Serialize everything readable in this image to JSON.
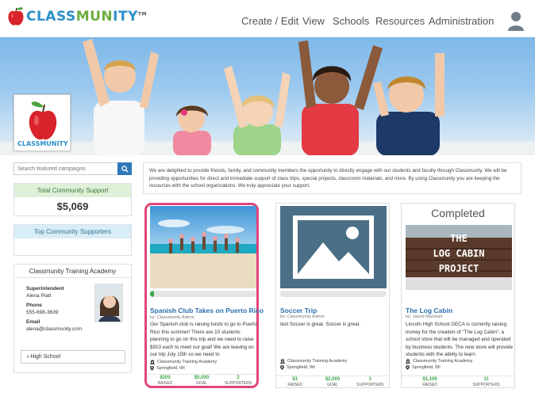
{
  "brand": {
    "name_part1": "CLASS",
    "name_part2": "MUN",
    "name_part3": "ITY",
    "tm": "TM",
    "badge_text": "CLASSMUNITY"
  },
  "nav": {
    "items": [
      "Create / Edit",
      "View",
      "Schools",
      "Resources",
      "Administration"
    ]
  },
  "search": {
    "placeholder": "Search featured campaigns"
  },
  "total_support": {
    "label": "Total Community Support",
    "value": "$5,069"
  },
  "top_supporters": {
    "label": "Top Community Supporters"
  },
  "academy": {
    "title": "Classmunity Training Academy",
    "role": "Superintendent",
    "name": "Alena Platt",
    "phone_label": "Phone",
    "phone": "555-698-3639",
    "email_label": "Email",
    "email": "alena@classmunity.com",
    "school_button": "High School"
  },
  "intro": {
    "text": "We are delighted to provide friends, family, and community members the opportunity to directly engage with our students and faculty through Classmunity. We will be providing opportunities for direct and immediate support of class trips, special projects, classroom materials, and more. By using Classmunity you are keeping the resources with the school organizations. We truly appreciate your support."
  },
  "campaigns": [
    {
      "title": "Spanish Club Takes on Puerto Rico",
      "by": "by: Classmunity Admin",
      "description": "Our Spanish club is raising funds to go to Puerto Rico this summer! There are 10 students planning to go on this trip and we need to raise $503 each to meet our goal! We are leaving on our trip July 15th so we need to",
      "org": "Classmunity Training Academy",
      "location": "Springfield, WI",
      "progress": 0.04,
      "raised": "$200",
      "raised_label": "RAISED",
      "goal": "$5,000",
      "goal_label": "GOAL",
      "supporters": "2",
      "supporters_label": "SUPPORTERS"
    },
    {
      "title": "Soccer Trip",
      "by": "by: Classmunity Admin",
      "description": "test Soccer is great. Soccer is great.",
      "org": "Classmunity Training Academy",
      "location": "Springfield, WI",
      "progress": 0.0,
      "raised": "$1",
      "raised_label": "RAISED",
      "goal": "$2,000",
      "goal_label": "GOAL",
      "supporters": "1",
      "supporters_label": "SUPPORTERS"
    },
    {
      "title": "The Log Cabin",
      "by": "by: Jacob Marshall",
      "description": "Lincoln High School DECA is currently raising money for the creation of \"The Log Cabin\", a school store that will be managed and operated by business students. The new store will provide students with the ability to learn",
      "org": "Classmunity Training Academy",
      "location": "Springfield, WI",
      "completed_label": "Completed",
      "image_text_1": "THE",
      "image_text_2": "LOG CABIN",
      "image_text_3": "PROJECT",
      "raised": "$1,106",
      "raised_label": "RAISED",
      "supporters": "11",
      "supporters_label": "SUPPORTERS"
    }
  ],
  "colors": {
    "brand_blue": "#2e8fc9",
    "brand_green": "#6cae3e",
    "highlight_pink": "#e0457b",
    "progress_green": "#3aa84a",
    "link_blue": "#2a6fb0"
  }
}
